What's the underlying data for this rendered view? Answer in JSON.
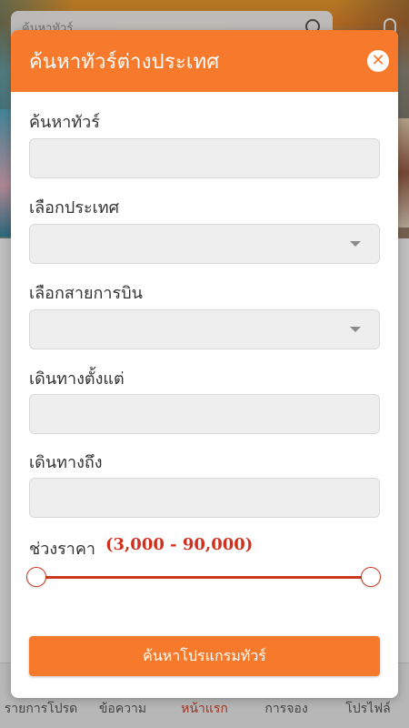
{
  "background": {
    "search_placeholder": "ค้นหาทัวร์",
    "bottom_nav": [
      {
        "label": "รายการโปรด"
      },
      {
        "label": "ข้อความ"
      },
      {
        "label": "หน้าแรก"
      },
      {
        "label": "การจอง"
      },
      {
        "label": "โปรไฟล์"
      }
    ]
  },
  "modal": {
    "title": "ค้นหาทัวร์ต่างประเทศ",
    "close_icon": "close-icon",
    "fields": {
      "tour_search": {
        "label": "ค้นหาทัวร์",
        "value": ""
      },
      "country": {
        "label": "เลือกประเทศ",
        "value": ""
      },
      "airline": {
        "label": "เลือกสายการบิน",
        "value": ""
      },
      "depart_from": {
        "label": "เดินทางตั้งแต่",
        "value": ""
      },
      "depart_to": {
        "label": "เดินทางถึง",
        "value": ""
      }
    },
    "price": {
      "label": "ช่วงราคา",
      "range_text": "(3,000 - 90,000)",
      "min": 3000,
      "max": 90000,
      "selected_min_fraction": 0,
      "selected_max_fraction": 1
    },
    "submit_label": "ค้นหาโปรแกรมทัวร์"
  },
  "colors": {
    "accent": "#f7792c",
    "price_red": "#d0311f"
  }
}
